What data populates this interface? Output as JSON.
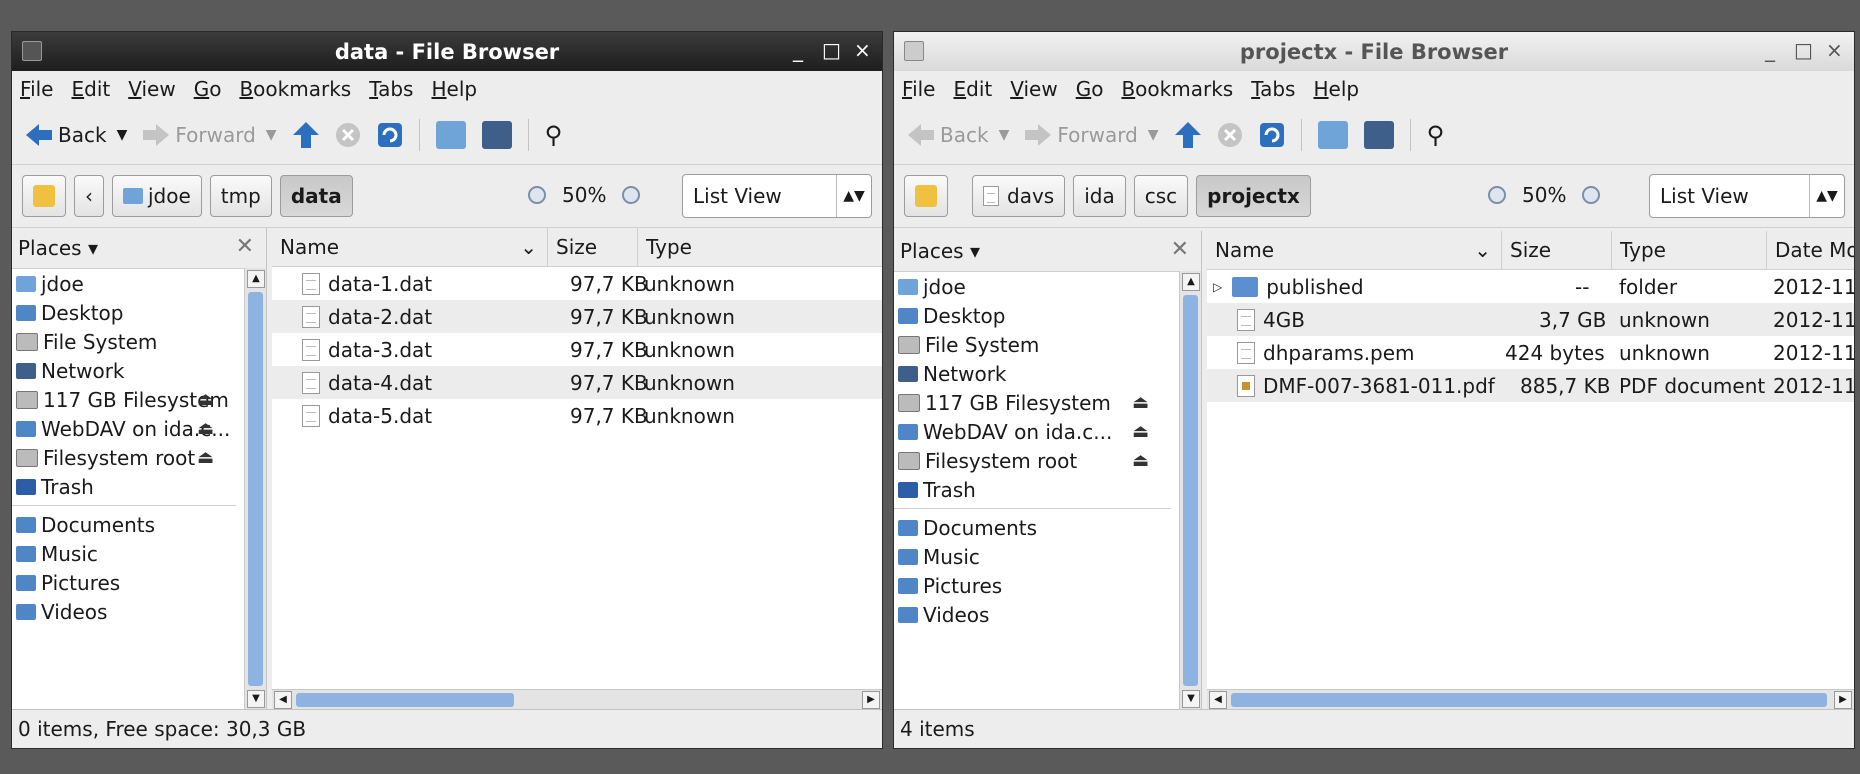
{
  "colors": {
    "folder": "#5b8fd0",
    "selection": "#8fb3e0",
    "active_title": "#2b2b2b"
  },
  "left": {
    "title": "data - File Browser",
    "controls": {
      "min": "_",
      "max": "□",
      "close": "×"
    },
    "menu": [
      {
        "u": "F",
        "rest": "ile"
      },
      {
        "u": "E",
        "rest": "dit"
      },
      {
        "u": "V",
        "rest": "iew"
      },
      {
        "u": "G",
        "rest": "o"
      },
      {
        "u": "B",
        "rest": "ookmarks"
      },
      {
        "u": "T",
        "rest": "abs"
      },
      {
        "u": "H",
        "rest": "elp"
      }
    ],
    "toolbar": {
      "back": "Back",
      "forward": "Forward"
    },
    "path_left_arrow": "‹",
    "path": [
      "jdoe",
      "tmp",
      "data"
    ],
    "zoom": "50%",
    "view": "List View",
    "places_label": "Places",
    "places": [
      {
        "name": "jdoe",
        "icon": "home-folder-icon",
        "eject": false
      },
      {
        "name": "Desktop",
        "icon": "desktop-folder-icon",
        "eject": false
      },
      {
        "name": "File System",
        "icon": "drive-icon",
        "eject": false
      },
      {
        "name": "Network",
        "icon": "network-icon",
        "eject": false
      },
      {
        "name": "117 GB Filesystem",
        "icon": "drive-icon",
        "eject": true
      },
      {
        "name": "WebDAV on ida.c...",
        "icon": "network-drive-icon",
        "eject": true
      },
      {
        "name": "Filesystem root",
        "icon": "drive-icon",
        "eject": true
      },
      {
        "name": "Trash",
        "icon": "trash-icon",
        "eject": false
      }
    ],
    "places2": [
      {
        "name": "Documents",
        "icon": "documents-folder-icon"
      },
      {
        "name": "Music",
        "icon": "music-folder-icon"
      },
      {
        "name": "Pictures",
        "icon": "pictures-folder-icon"
      },
      {
        "name": "Videos",
        "icon": "videos-folder-icon"
      }
    ],
    "columns": {
      "name": "Name",
      "size": "Size",
      "type": "Type"
    },
    "files": [
      {
        "name": "data-1.dat",
        "size": "97,7 KB",
        "type": "unknown"
      },
      {
        "name": "data-2.dat",
        "size": "97,7 KB",
        "type": "unknown"
      },
      {
        "name": "data-3.dat",
        "size": "97,7 KB",
        "type": "unknown"
      },
      {
        "name": "data-4.dat",
        "size": "97,7 KB",
        "type": "unknown"
      },
      {
        "name": "data-5.dat",
        "size": "97,7 KB",
        "type": "unknown"
      }
    ],
    "status": "0 items, Free space: 30,3 GB"
  },
  "right": {
    "title": "projectx - File Browser",
    "controls": {
      "min": "_",
      "max": "□",
      "close": "×"
    },
    "menu": [
      {
        "u": "F",
        "rest": "ile"
      },
      {
        "u": "E",
        "rest": "dit"
      },
      {
        "u": "V",
        "rest": "iew"
      },
      {
        "u": "G",
        "rest": "o"
      },
      {
        "u": "B",
        "rest": "ookmarks"
      },
      {
        "u": "T",
        "rest": "abs"
      },
      {
        "u": "H",
        "rest": "elp"
      }
    ],
    "toolbar": {
      "back": "Back",
      "forward": "Forward"
    },
    "path": [
      "davs",
      "ida",
      "csc",
      "projectx"
    ],
    "zoom": "50%",
    "view": "List View",
    "places_label": "Places",
    "places": [
      {
        "name": "jdoe",
        "icon": "home-folder-icon",
        "eject": false
      },
      {
        "name": "Desktop",
        "icon": "desktop-folder-icon",
        "eject": false
      },
      {
        "name": "File System",
        "icon": "drive-icon",
        "eject": false
      },
      {
        "name": "Network",
        "icon": "network-icon",
        "eject": false
      },
      {
        "name": "117 GB Filesystem",
        "icon": "drive-icon",
        "eject": true
      },
      {
        "name": "WebDAV on ida.c...",
        "icon": "network-drive-icon",
        "eject": true
      },
      {
        "name": "Filesystem root",
        "icon": "drive-icon",
        "eject": true
      },
      {
        "name": "Trash",
        "icon": "trash-icon",
        "eject": false
      }
    ],
    "places2": [
      {
        "name": "Documents",
        "icon": "documents-folder-icon"
      },
      {
        "name": "Music",
        "icon": "music-folder-icon"
      },
      {
        "name": "Pictures",
        "icon": "pictures-folder-icon"
      },
      {
        "name": "Videos",
        "icon": "videos-folder-icon"
      }
    ],
    "columns": {
      "name": "Name",
      "size": "Size",
      "type": "Type",
      "date": "Date Mo"
    },
    "files": [
      {
        "name": "published",
        "size": "--",
        "type": "folder",
        "date": "2012-11-",
        "kind": "folder"
      },
      {
        "name": "4GB",
        "size": "3,7 GB",
        "type": "unknown",
        "date": "2012-11-",
        "kind": "file"
      },
      {
        "name": "dhparams.pem",
        "size": "424 bytes",
        "type": "unknown",
        "date": "2012-11-",
        "kind": "file"
      },
      {
        "name": "DMF-007-3681-011.pdf",
        "size": "885,7 KB",
        "type": "PDF document",
        "date": "2012-11-",
        "kind": "pdf"
      }
    ],
    "status": "4 items"
  }
}
